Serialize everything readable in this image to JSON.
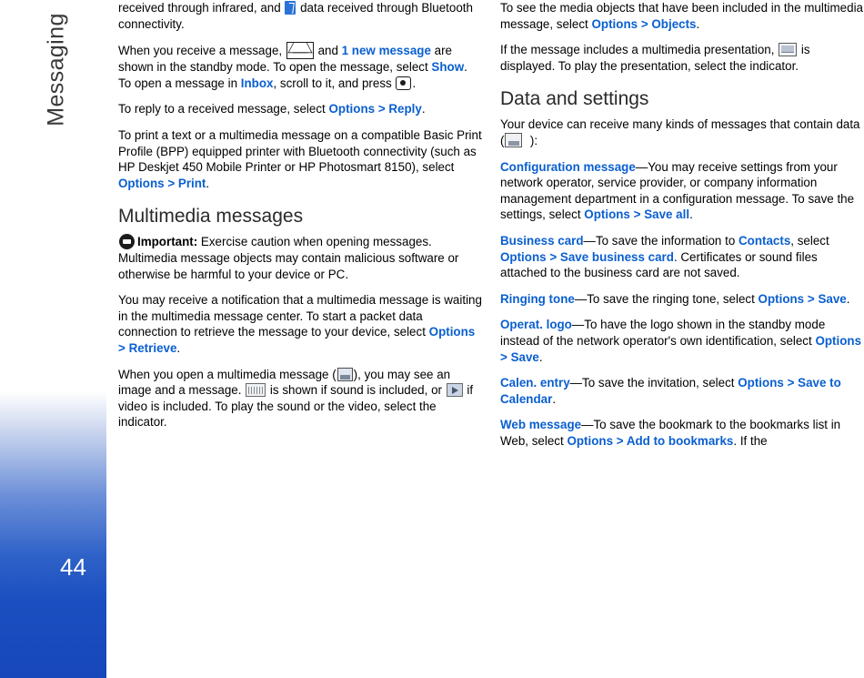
{
  "sidebar": {
    "chapter_title": "Messaging",
    "page_number": "44"
  },
  "icons": {
    "bluetooth": "bluetooth-icon",
    "envelope": "envelope-icon",
    "navi_key": "navi-key-icon",
    "important": "important-icon",
    "mms": "mms-message-icon",
    "sound": "sound-clip-icon",
    "video": "video-clip-icon",
    "presentation": "presentation-icon",
    "data": "data-message-icon"
  },
  "colors": {
    "link_blue": "#0a5fd0",
    "sidebar_blue": "#1b4fc0",
    "heading_gray": "#2a2a2a"
  },
  "left_column": {
    "p1_a": "received through infrared, and ",
    "p1_b": " data received through Bluetooth connectivity.",
    "p2_a": "When you receive a message, ",
    "p2_b": " and ",
    "p2_link1": "1 new message",
    "p2_c": " are shown in the standby mode. To open the message, select ",
    "p2_link2": "Show",
    "p2_d": ". To open a message in ",
    "p2_link3": "Inbox",
    "p2_e": ", scroll to it, and press ",
    "p2_f": ".",
    "p3_a": "To reply to a received message, select ",
    "p3_link1": "Options",
    "p3_gt": ">",
    "p3_link2": "Reply",
    "p3_b": ".",
    "p4_a": "To print a text or a multimedia message on a compatible Basic Print Profile (BPP) equipped printer with Bluetooth connectivity (such as HP Deskjet 450 Mobile Printer or HP Photosmart 8150), select ",
    "p4_link1": "Options",
    "p4_gt": ">",
    "p4_link2": "Print",
    "p4_b": ".",
    "heading1": "Multimedia messages",
    "p5_bold": "Important:",
    "p5_text": " Exercise caution when opening messages. Multimedia message objects may contain malicious software or otherwise be harmful to your device or PC.",
    "p6_a": "You may receive a notification that a multimedia message is waiting in the multimedia message center. To start a packet data connection to retrieve the message to your device, select ",
    "p6_link1": "Options",
    "p6_gt": ">",
    "p6_link2": "Retrieve",
    "p6_b": ".",
    "p7_a": "When you open a multimedia message (",
    "p7_b": "), you may see an image and a message. ",
    "p7_c": " is shown if sound is included, or ",
    "p7_d": " if video is included. To play the sound or the video, select the indicator."
  },
  "right_column": {
    "p1_a": "To see the media objects that have been included in the multimedia message, select ",
    "p1_link1": "Options",
    "p1_gt": ">",
    "p1_link2": "Objects",
    "p1_b": ".",
    "p2_a": "If the message includes a multimedia presentation, ",
    "p2_b": " is displayed. To play the presentation, select the indicator.",
    "heading1": "Data and settings",
    "p3_a": "Your device can receive many kinds of messages that contain data (",
    "p3_b": "):",
    "p4_link": "Configuration message",
    "p4_a": "—You may receive settings from your network operator, service provider, or company information management department in a configuration message. To save the settings, select ",
    "p4_link2": "Options",
    "p4_gt": ">",
    "p4_link3": "Save all",
    "p4_b": ".",
    "p5_link": "Business card",
    "p5_a": "—To save the information to ",
    "p5_link2": "Contacts",
    "p5_b": ", select ",
    "p5_link3": "Options",
    "p5_gt": ">",
    "p5_link4": "Save business card",
    "p5_c": ". Certificates or sound files attached to the business card are not saved.",
    "p6_link": "Ringing tone",
    "p6_a": "—To save the ringing tone, select ",
    "p6_link2": "Options",
    "p6_gt": ">",
    "p6_link3": "Save",
    "p6_b": ".",
    "p7_link": "Operat. logo",
    "p7_a": "—To have the logo shown in the standby mode instead of the network operator's own identification, select ",
    "p7_link2": "Options",
    "p7_gt": ">",
    "p7_link3": "Save",
    "p7_b": ".",
    "p8_link": "Calen. entry",
    "p8_a": "—To save the invitation, select ",
    "p8_link2": "Options",
    "p8_gt": ">",
    "p8_link3": "Save to Calendar",
    "p8_b": ".",
    "p9_link": "Web message",
    "p9_a": "—To save the bookmark to the bookmarks list in Web, select ",
    "p9_link2": "Options",
    "p9_gt": ">",
    "p9_link3": "Add to bookmarks",
    "p9_b": ". If the"
  }
}
